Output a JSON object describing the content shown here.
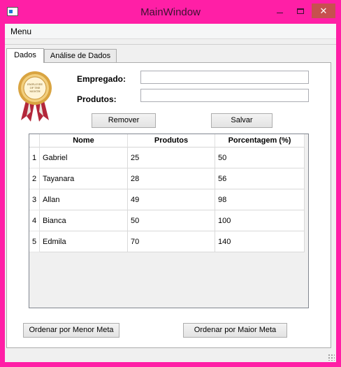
{
  "window": {
    "title": "MainWindow",
    "close_glyph": "✕"
  },
  "menubar": {
    "menu_label": "Menu"
  },
  "tabs": [
    {
      "label": "Dados",
      "active": true
    },
    {
      "label": "Análise de Dados",
      "active": false
    }
  ],
  "form": {
    "empregado_label": "Empregado:",
    "empregado_value": "",
    "produtos_label": "Produtos:",
    "produtos_value": "",
    "medal_icon": "employee-of-the-month-medal-icon",
    "medal_text": "EMPLOYEE OF THE MONTH"
  },
  "buttons": {
    "remover": "Remover",
    "salvar": "Salvar",
    "ordenar_menor": "Ordenar por Menor Meta",
    "ordenar_maior": "Ordenar por Maior Meta"
  },
  "table": {
    "columns": [
      "Nome",
      "Produtos",
      "Porcentagem (%)"
    ],
    "rows": [
      {
        "num": "1",
        "nome": "Gabriel",
        "produtos": "25",
        "porcentagem": "50"
      },
      {
        "num": "2",
        "nome": "Tayanara",
        "produtos": "28",
        "porcentagem": "56"
      },
      {
        "num": "3",
        "nome": "Allan",
        "produtos": "49",
        "porcentagem": "98"
      },
      {
        "num": "4",
        "nome": "Bianca",
        "produtos": "50",
        "porcentagem": "100"
      },
      {
        "num": "5",
        "nome": "Edmila",
        "produtos": "70",
        "porcentagem": "140"
      }
    ]
  },
  "colors": {
    "window_frame": "#ff1fa6",
    "close_button": "#c7504f",
    "medal_gold": "#d9a441",
    "ribbon_red": "#b3273a"
  }
}
